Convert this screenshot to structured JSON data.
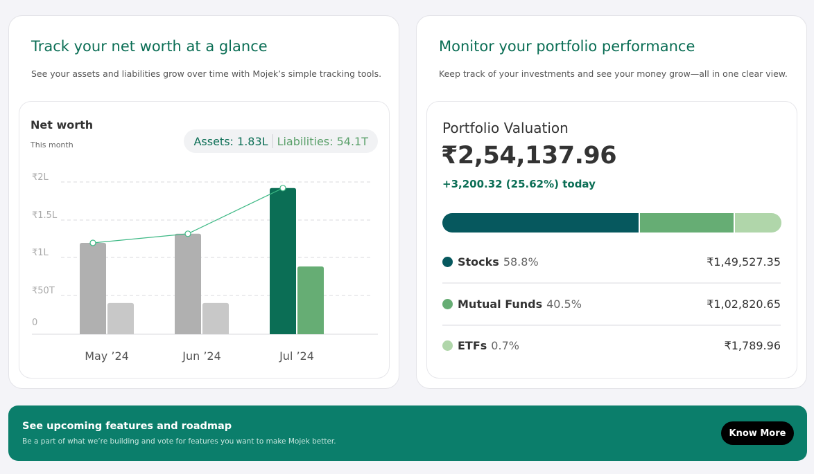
{
  "networth_card": {
    "title": "Track your net worth at a glance",
    "subtitle": "See your assets and liabilities grow over time with Mojek’s simple tracking tools.",
    "widget_title": "Net worth",
    "widget_sub": "This month",
    "assets_label": "Assets: 1.83L",
    "liabilities_label": "Liabilities: 54.1T"
  },
  "chart_data": {
    "type": "bar",
    "categories": [
      "May ’24",
      "Jun ’24",
      "Jul ’24"
    ],
    "y_ticks": [
      "0",
      "₹50T",
      "₹1L",
      "₹1.5L",
      "₹2L"
    ],
    "ylim": [
      0,
      200000
    ],
    "series": [
      {
        "name": "Assets",
        "values": [
          120000,
          132000,
          192000
        ]
      },
      {
        "name": "Liabilities",
        "values": [
          41000,
          41000,
          89000
        ]
      },
      {
        "name": "Net worth",
        "values": [
          120000,
          132000,
          192000
        ],
        "render": "line"
      }
    ],
    "grid": true,
    "colors": {
      "past_assets": "#b0b0b0",
      "past_liabilities": "#c8c8c8",
      "current_assets": "#0b6e55",
      "current_liabilities": "#66ad74",
      "line": "#3cb884"
    }
  },
  "portfolio_card": {
    "title": "Monitor your portfolio performance",
    "subtitle": "Keep track of your investments and see your money grow—all in one clear view.",
    "widget_title": "Portfolio Valuation",
    "value": "₹2,54,137.96",
    "change": "+3,200.32 (25.62%) today",
    "holdings": [
      {
        "name": "Stocks",
        "pct": "58.8%",
        "amount": "₹1,49,527.35",
        "color": "#06585e",
        "share": 0.588
      },
      {
        "name": "Mutual Funds",
        "pct": "40.5%",
        "amount": "₹1,02,820.65",
        "color": "#66ad74",
        "share": 0.28
      },
      {
        "name": "ETFs",
        "pct": "0.7%",
        "amount": "₹1,789.96",
        "color": "#b0d6aa",
        "share": 0.14
      }
    ]
  },
  "banner": {
    "title": "See upcoming features and roadmap",
    "subtitle": "Be a part of what we’re building and vote for features you want to make Mojek better.",
    "button_label": "Know More"
  }
}
